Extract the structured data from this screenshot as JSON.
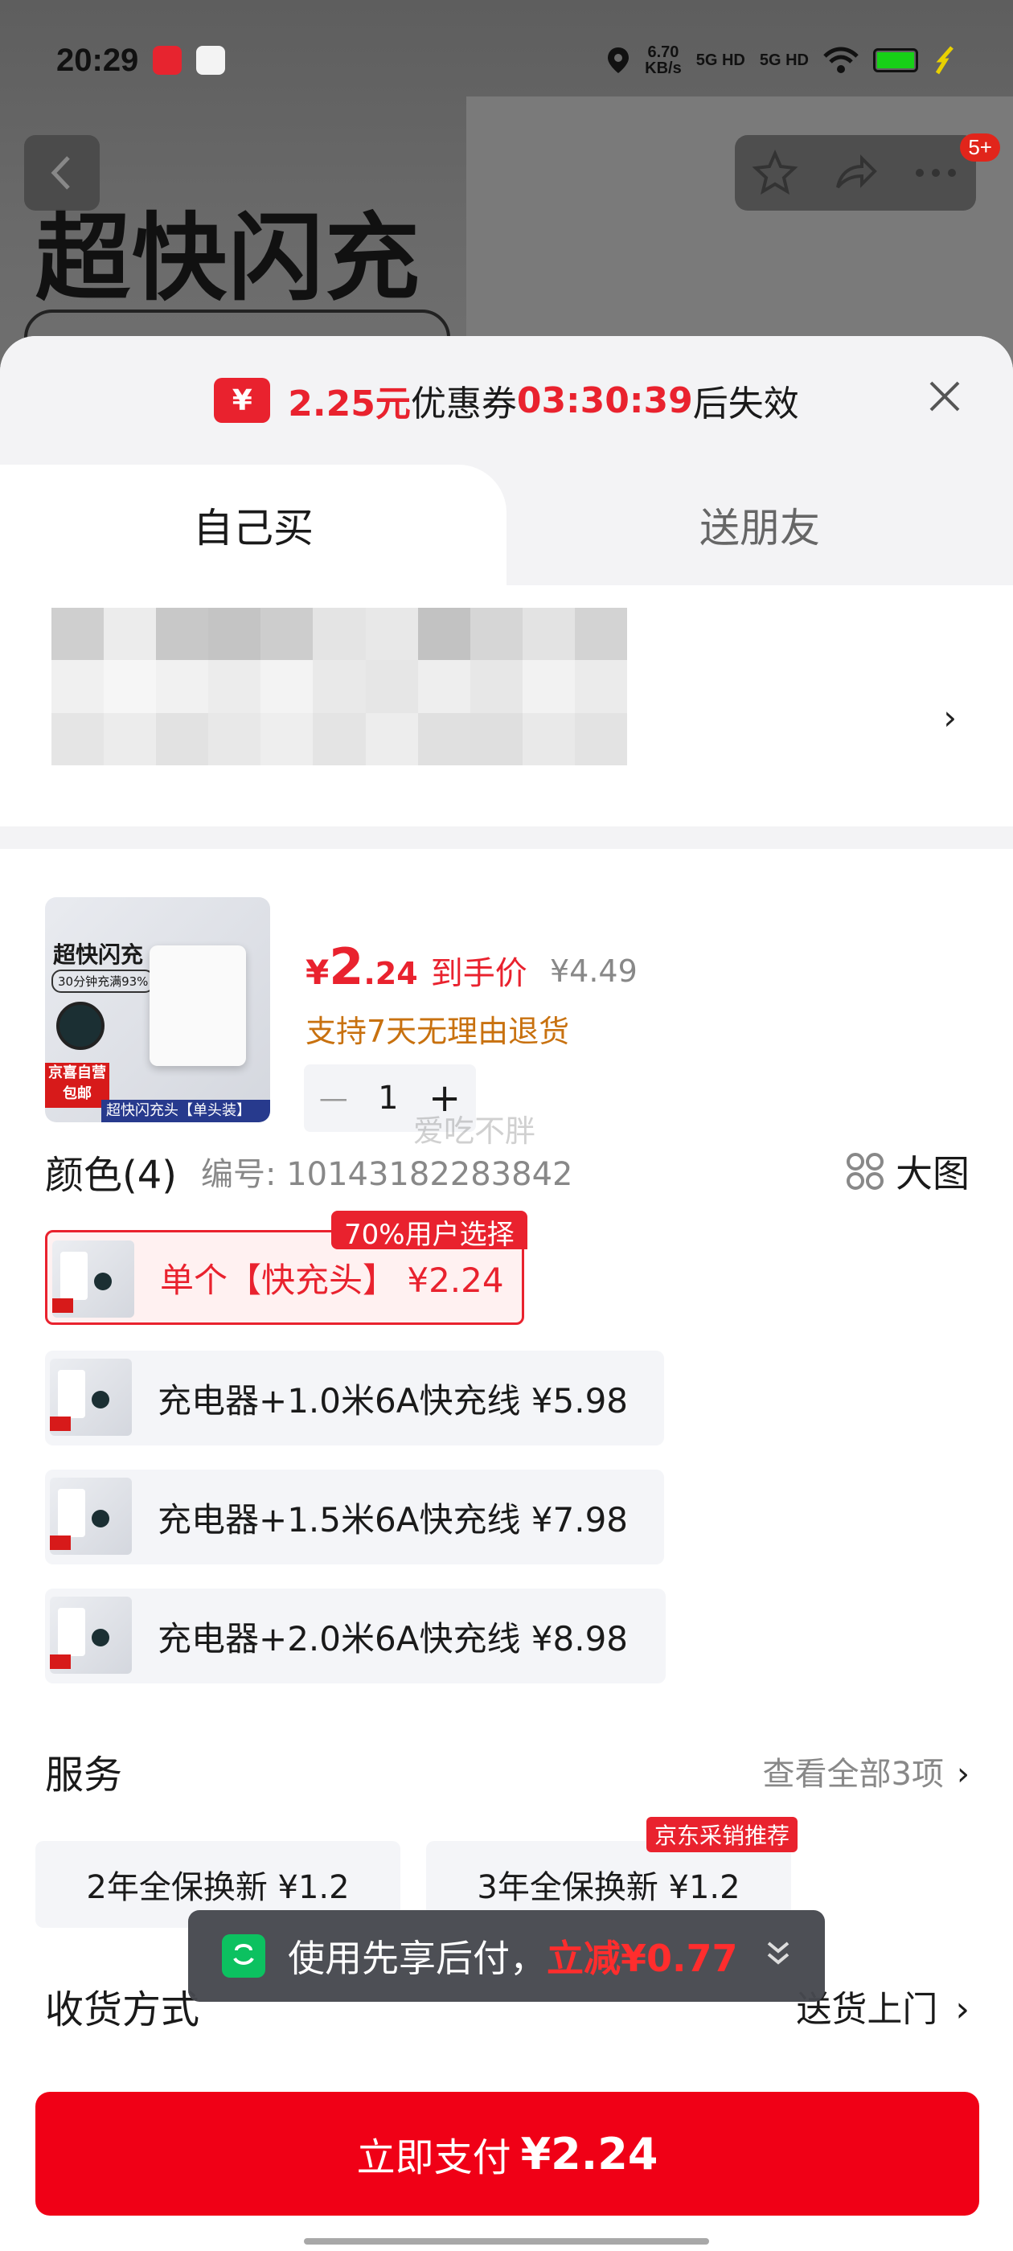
{
  "status_bar": {
    "time": "20:29",
    "network_speed": "6.70",
    "network_speed_unit": "KB/s",
    "signal_1": "5G HD",
    "signal_2": "5G HD"
  },
  "background": {
    "headline": "超快闪充",
    "badge_count": "5+"
  },
  "coupon_banner": {
    "amount": "2.25元",
    "text_mid": "优惠券",
    "countdown": "03:30:39",
    "text_end": "后失效",
    "icon_glyph": "¥"
  },
  "tabs": [
    {
      "label": "自己买",
      "active": true
    },
    {
      "label": "送朋友",
      "active": false
    }
  ],
  "address": {
    "arrow": "›"
  },
  "product": {
    "thumb_title": "超快闪充",
    "thumb_sub": "30分钟充满93%",
    "thumb_badge": "京喜自营 包邮",
    "thumb_caption": "超快闪充头【单头装】",
    "currency": "¥",
    "price_int": "2",
    "price_dec": ".24",
    "price_label": "到手价",
    "original_price": "¥4.49",
    "return_policy": "支持7天无理由退货",
    "quantity": "1",
    "minus": "—",
    "plus": "+",
    "watermark": "爱吃不胖"
  },
  "color_section": {
    "title": "颜色(4)",
    "code": "编号: 10143182283842",
    "big_view": "大图",
    "tag": "70%用户选择",
    "options": [
      {
        "label": "单个【快充头】 ¥2.24",
        "selected": true
      },
      {
        "label": "充电器+1.0米6A快充线  ¥5.98",
        "selected": false
      },
      {
        "label": "充电器+1.5米6A快充线  ¥7.98",
        "selected": false
      },
      {
        "label": "充电器+2.0米6A快充线  ¥8.98",
        "selected": false
      }
    ]
  },
  "service": {
    "title": "服务",
    "view_all": "查看全部3项",
    "arrow": "›",
    "tag": "京东采销推荐",
    "options": [
      {
        "label": "2年全保换新  ¥1.2"
      },
      {
        "label": "3年全保换新  ¥1.2"
      }
    ]
  },
  "shipping": {
    "title": "收货方式",
    "value": "送货上门",
    "arrow": "›"
  },
  "toast": {
    "text": "使用先享后付，",
    "red_text": "立减¥0.77",
    "chevron": "⌄"
  },
  "pay_button": {
    "label": "立即支付",
    "amount": "¥2.24"
  },
  "colors": {
    "accent_red": "#e9222e",
    "pay_red": "#f00016",
    "return_orange": "#c8710f",
    "toast_green": "#0cc160"
  }
}
